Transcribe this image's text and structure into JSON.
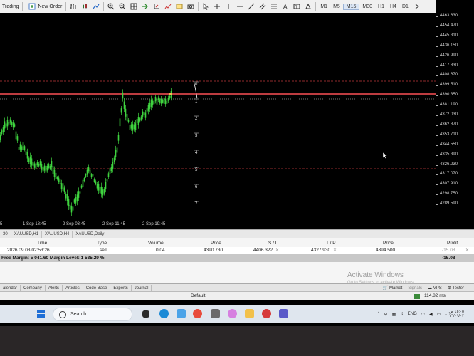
{
  "toolbar": {
    "trading_label": "Trading",
    "new_order_label": "New Order",
    "timeframes": [
      "M1",
      "M5",
      "M15",
      "M30",
      "H1",
      "H4",
      "D1"
    ],
    "active_timeframe": "M15"
  },
  "price_axis": {
    "labels": [
      "4463.630",
      "4454.470",
      "4445.310",
      "4436.150",
      "4426.990",
      "4417.830",
      "4408.670",
      "4399.510",
      "4390.350",
      "4381.190",
      "4372.030",
      "4362.870",
      "4353.710",
      "4344.550",
      "4335.390",
      "4326.230",
      "4317.070",
      "4307.910",
      "4298.750",
      "4289.590"
    ]
  },
  "time_axis": {
    "labels": [
      "5",
      "1 Sep 18:45",
      "2 Sep 03:45",
      "2 Sep 11:45",
      "2 Sep 19:45"
    ]
  },
  "fib_levels": [
    "0",
    "1",
    "2",
    "3",
    "4",
    "5",
    "6",
    "7"
  ],
  "chart_tabs": [
    "30",
    "XAUUSD,H1",
    "XAUUSD,H4",
    "XAUUSD,Daily"
  ],
  "terminal": {
    "headers": {
      "time": "Time",
      "type": "Type",
      "volume": "Volume",
      "price": "Price",
      "sl": "S / L",
      "tp": "T / P",
      "price2": "Price",
      "profit": "Profit"
    },
    "row": {
      "time": "2026.09.03 02:53:26",
      "type": "sell",
      "volume": "0.04",
      "price": "4390.730",
      "sl": "4406.322",
      "tp": "4327.930",
      "price2": "4394.500",
      "profit": "-15.08"
    },
    "summary_text": "Free Margin: 5 041.60  Margin Level: 1 535.29 %",
    "summary_profit": "-15.08",
    "watermark_title": "Activate Windows",
    "watermark_sub": "Go to Settings to activate Windows."
  },
  "tool_tabs": [
    "alendar",
    "Company",
    "Alerts",
    "Articles",
    "Code Base",
    "Experts",
    "Journal"
  ],
  "tool_right": {
    "market": "Market",
    "signals": "Signals",
    "vps": "VPS",
    "tester": "Tester"
  },
  "statusbar": {
    "profile": "Default",
    "ping": "114.82 ms"
  },
  "taskbar": {
    "search_placeholder": "Search",
    "lang": "ENG",
    "time": "٤٥:٠٥ ص",
    "date": "٢٠٢٦/٠٩/٠٣"
  },
  "colors": {
    "candle": "#3fd33f",
    "level_line": "#c0383a",
    "trendline": "#ffffff"
  }
}
